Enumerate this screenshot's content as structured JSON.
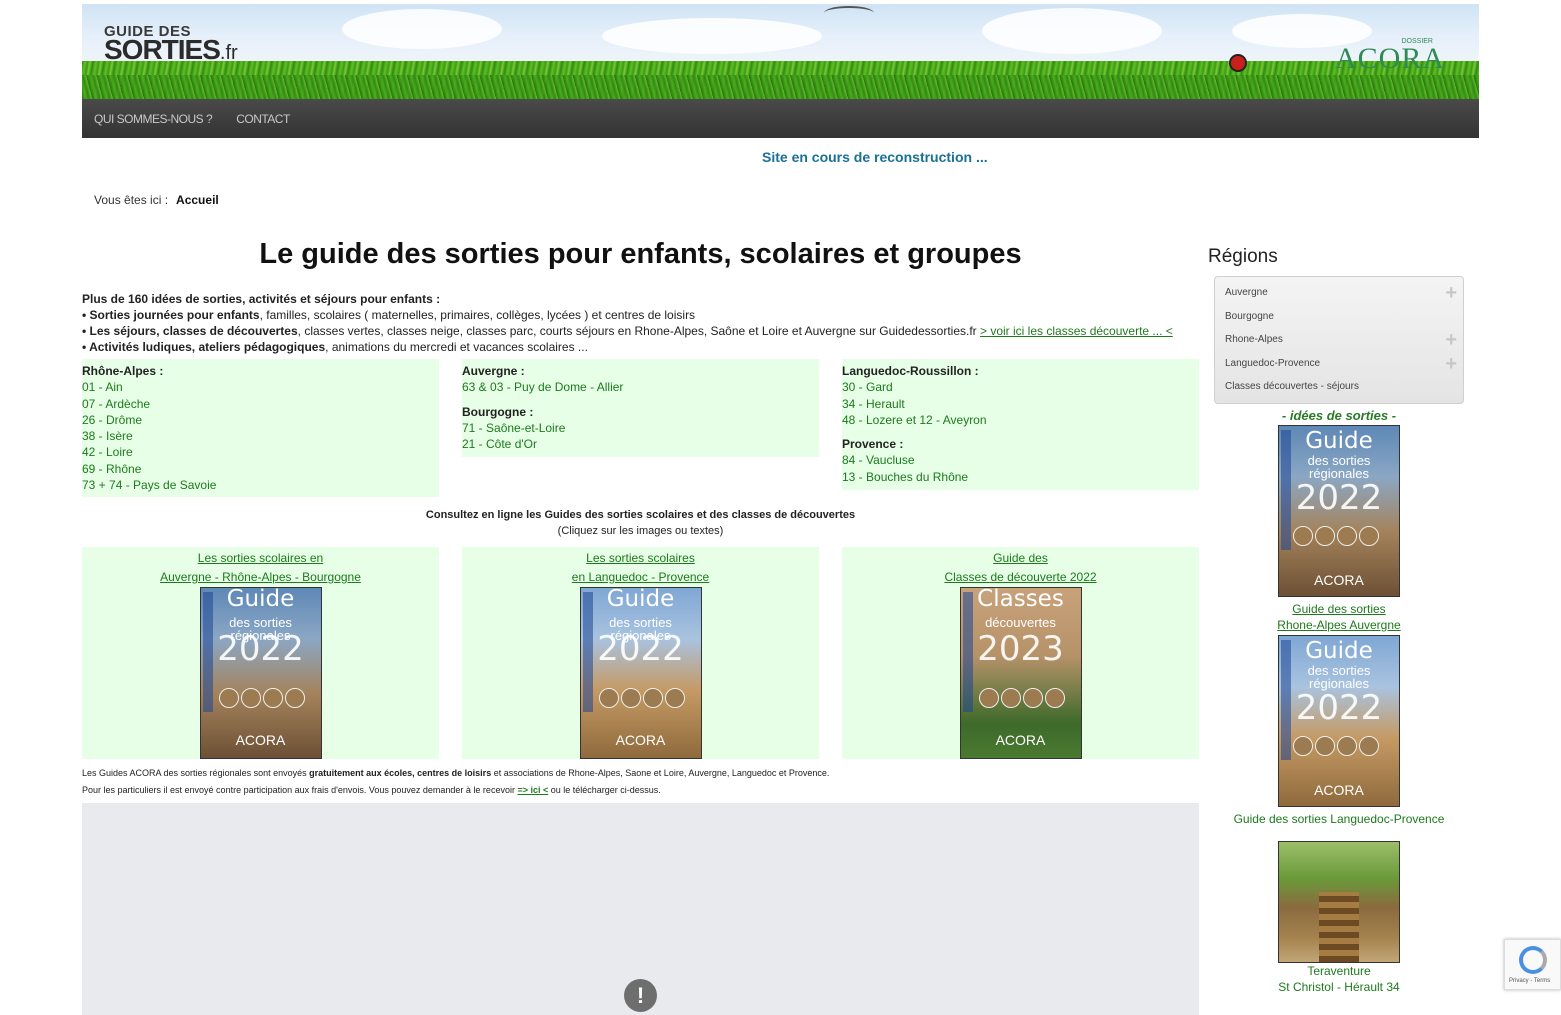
{
  "header": {
    "logo_top": "GUIDE DES",
    "logo_main": "SORTIES",
    "logo_suffix": ".fr",
    "acora": "ACORA",
    "dossier": "DOSSIER"
  },
  "nav": {
    "items": [
      "QUI SOMMES-NOUS ?",
      "CONTACT"
    ]
  },
  "notice": "Site en cours de reconstruction ...",
  "breadcrumb": {
    "label": "Vous êtes ici :",
    "current": "Accueil"
  },
  "main": {
    "title": "Le guide des sorties pour enfants, scolaires et groupes",
    "intro": {
      "headline": "Plus de 160 idées de sorties, activités et séjours pour enfants :",
      "line1_bold": "• Sorties journées pour enfants",
      "line1_rest": ", familles, scolaires ( maternelles, primaires, collèges, lycées ) et centres de loisirs",
      "line2_bold": "• Les séjours, classes de découvertes",
      "line2_rest": ", classes vertes, classes neige, classes parc, courts séjours en Rhone-Alpes, Saône et Loire et Auvergne sur Guidedessorties.fr ",
      "line2_link": "> voir ici les classes découverte ... <",
      "line3_bold": "• Activités ludiques, ateliers pédagogiques",
      "line3_rest": ", animations du mercredi et vacances scolaires ..."
    },
    "regions": {
      "rhone_alpes": {
        "title": "Rhône-Alpes :",
        "items": [
          "01 - Ain",
          "07 - Ardèche",
          "26 - Drôme",
          "38 - Isère",
          "42 - Loire",
          "69 - Rhône",
          "73 + 74 - Pays de Savoie"
        ]
      },
      "auvergne": {
        "title": "Auvergne :",
        "items": [
          "63 & 03  - Puy de Dome - Allier"
        ]
      },
      "bourgogne": {
        "title": "Bourgogne :",
        "items": [
          "71 - Saône-et-Loire",
          "21 - Côte d'Or"
        ]
      },
      "languedoc": {
        "title": "Languedoc-Roussillon :",
        "items": [
          "30 - Gard",
          "34 - Herault",
          "48 - Lozere et 12 - Aveyron"
        ]
      },
      "provence": {
        "title": "Provence :",
        "items": [
          "84 - Vaucluse",
          "13 - Bouches du Rhône"
        ]
      }
    },
    "consult": {
      "line1": "Consultez en ligne les Guides des sorties scolaires et des classes de découvertes",
      "line2": "(Cliquez sur les images ou textes)"
    },
    "guides": [
      {
        "line1": "Les sorties scolaires en",
        "line2": "Auvergne - Rhône-Alpes - Bourgogne",
        "cover_t1": "Guide",
        "cover_t2": "des sorties régionales",
        "cover_year": "2022",
        "cover_brand": "ACORA"
      },
      {
        "line1": "Les sorties scolaires",
        "line2": "en Languedoc - Provence",
        "cover_t1": "Guide",
        "cover_t2": "des sorties régionales",
        "cover_year": "2022",
        "cover_brand": "ACORA"
      },
      {
        "line1": "Guide des",
        "line2": "Classes de découverte 2022",
        "cover_t1": "Classes",
        "cover_t2": "découvertes",
        "cover_year": "2023",
        "cover_brand": "ACORA"
      }
    ],
    "footer": {
      "p1_a": "Les Guides ACORA des sorties régionales sont envoyés ",
      "p1_bold": "gratuitement aux écoles, centres de loisirs",
      "p1_b": " et associations de Rhone-Alpes, Saone et Loire, Auvergne, Languedoc et Provence.",
      "p2_a": "Pour les particuliers il est envoyé contre participation aux frais d'envois. Vous pouvez demander à le recevoir ",
      "p2_link": "=> ici <",
      "p2_b": " ou le télécharger ci-dessus."
    },
    "video_alert": "!"
  },
  "sidebar": {
    "title": "Régions",
    "menu": [
      {
        "label": "Auvergne",
        "expand": "+"
      },
      {
        "label": "Bourgogne",
        "expand": ""
      },
      {
        "label": "Rhone-Alpes",
        "expand": "+"
      },
      {
        "label": "Languedoc-Provence",
        "expand": "+"
      },
      {
        "label": "Classes découvertes - séjours",
        "expand": ""
      }
    ],
    "ideas": "- idées de sorties -",
    "link1_a": "Guide des sorties",
    "link1_b": "Rhone-Alpes Auvergne",
    "link2": "Guide des sorties Languedoc-Provence",
    "link3_a": "Teraventure",
    "link3_b": "St Christol - Hérault 34"
  },
  "recaptcha": {
    "text": "Privacy - Terms"
  },
  "colors": {
    "nav_bg": "#333333",
    "notice": "#1a7096",
    "link": "#1d7a1d",
    "panel_bg": "#e6ffe6"
  }
}
